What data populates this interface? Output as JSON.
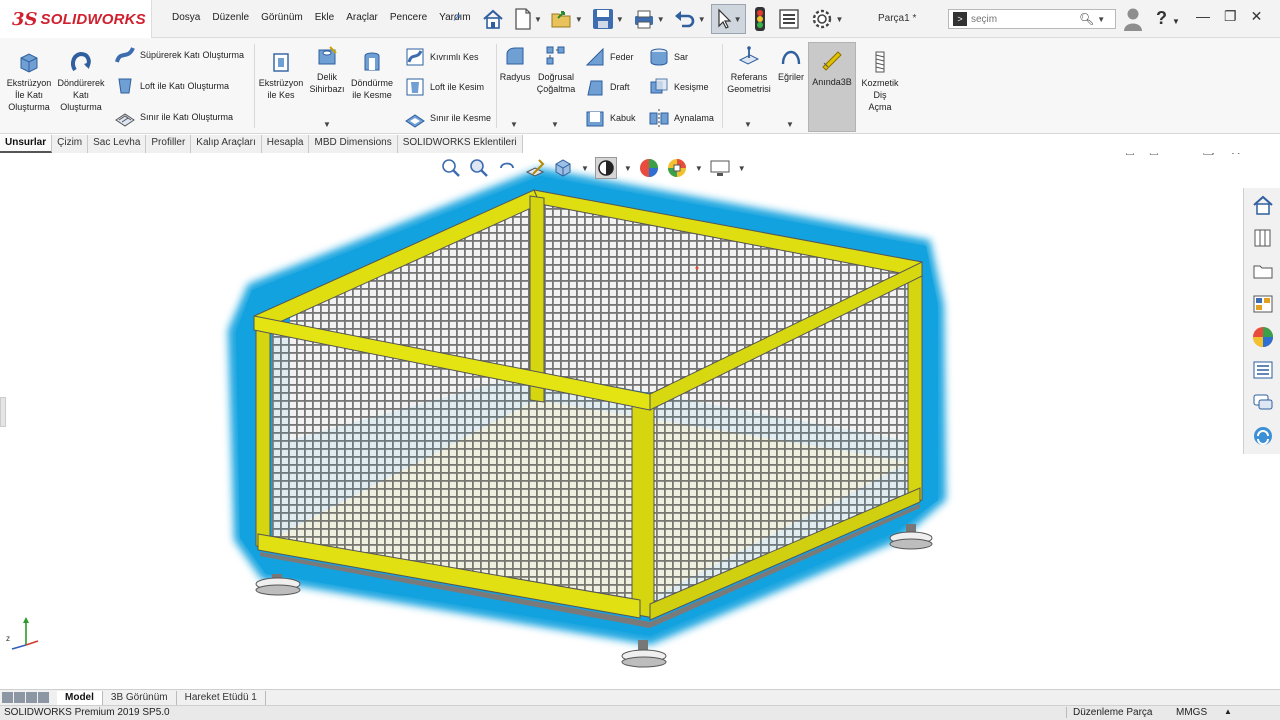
{
  "app": {
    "logo_prefix": "3S",
    "logo_word": "SOLIDWORKS",
    "document_title": "Parça1 *"
  },
  "menu": [
    "Dosya",
    "Düzenle",
    "Görünüm",
    "Ekle",
    "Araçlar",
    "Pencere",
    "Yardım"
  ],
  "search": {
    "placeholder": "seçim"
  },
  "commands": {
    "extrude": "Ekstrüzyon\nİle Katı\nOluşturma",
    "revolve": "Döndürerek\nKatı\nOluşturma",
    "sweep": "Süpürerek Katı Oluşturma",
    "loft": "Loft ile Katı Oluşturma",
    "boundary": "Sınır ile Katı Oluşturma",
    "extrude_cut": "Ekstrüzyon\nile Kes",
    "hole_wizard": "Delik\nSihirbazı",
    "revolve_cut": "Döndürme\nile Kesme",
    "swept_cut": "Kıvrımlı Kes",
    "loft_cut": "Loft ile Kesim",
    "boundary_cut": "Sınır ile Kesme",
    "fillet": "Radyus",
    "linear_pattern": "Doğrusal\nÇoğaltma",
    "rib": "Feder",
    "draft": "Draft",
    "shell": "Kabuk",
    "wrap": "Sar",
    "intersect": "Kesişme",
    "mirror": "Aynalama",
    "ref_geometry": "Referans\nGeometrisi",
    "curves": "Eğriler",
    "instant3d": "Anında3B",
    "cosmetic_thread": "Kozmetik\nDiş\nAçma"
  },
  "tabs": [
    "Unsurlar",
    "Çizim",
    "Sac Levha",
    "Profiller",
    "Kalıp Araçları",
    "Hesapla",
    "MBD Dimensions",
    "SOLIDWORKS Eklentileri"
  ],
  "active_tab": "Unsurlar",
  "model_tabs": [
    "Model",
    "3B Görünüm",
    "Hareket Etüdü 1"
  ],
  "active_model_tab": "Model",
  "status": {
    "left": "SOLIDWORKS Premium 2019 SP5.0",
    "mode": "Düzenleme Parça",
    "units": "MMGS"
  },
  "colors": {
    "frame": "#d4d400",
    "selection_glow": "#1aa6e0",
    "mesh": "#6e6e6e",
    "accent": "#d0202e"
  }
}
